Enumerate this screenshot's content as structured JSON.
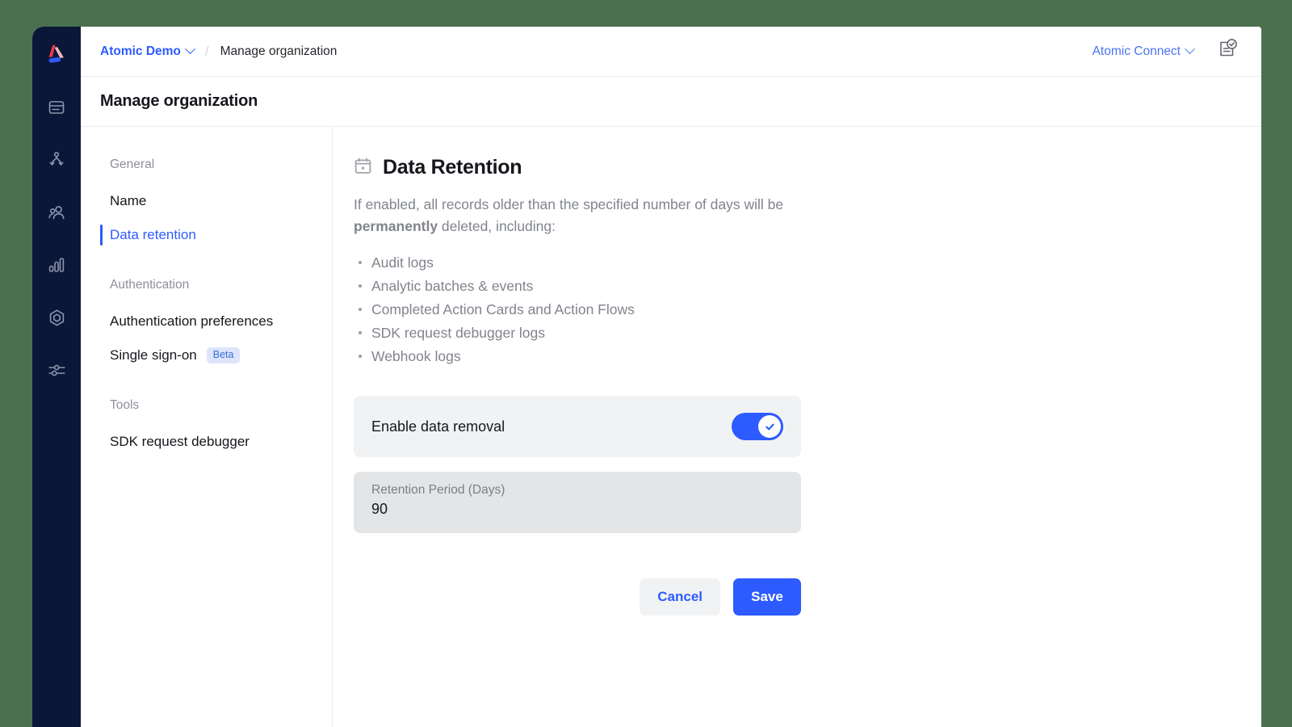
{
  "breadcrumb": {
    "org": "Atomic Demo",
    "separator": "/",
    "current": "Manage organization"
  },
  "topbar": {
    "connect_label": "Atomic Connect",
    "doc_check_icon": "document-check-icon"
  },
  "page": {
    "title": "Manage organization"
  },
  "rail": {
    "logo_icon": "atomic-logo-icon",
    "items": [
      {
        "icon": "card-list-icon"
      },
      {
        "icon": "flow-branch-icon"
      },
      {
        "icon": "people-icon"
      },
      {
        "icon": "bar-chart-icon"
      },
      {
        "icon": "hexagon-icon"
      },
      {
        "icon": "sliders-icon"
      }
    ]
  },
  "settings_nav": {
    "groups": [
      {
        "label": "General",
        "items": [
          {
            "label": "Name",
            "active": false,
            "badge": null
          },
          {
            "label": "Data retention",
            "active": true,
            "badge": null
          }
        ]
      },
      {
        "label": "Authentication",
        "items": [
          {
            "label": "Authentication preferences",
            "active": false,
            "badge": null
          },
          {
            "label": "Single sign-on",
            "active": false,
            "badge": "Beta"
          }
        ]
      },
      {
        "label": "Tools",
        "items": [
          {
            "label": "SDK request debugger",
            "active": false,
            "badge": null
          }
        ]
      }
    ]
  },
  "section": {
    "icon": "calendar-icon",
    "title": "Data Retention",
    "description_part1": "If enabled, all records older than the specified number of days will be ",
    "description_bold": "permanently",
    "description_part2": " deleted, including:",
    "bullets": [
      "Audit logs",
      "Analytic batches & events",
      "Completed Action Cards and Action Flows",
      "SDK request debugger logs",
      "Webhook logs"
    ]
  },
  "form": {
    "toggle_label": "Enable data removal",
    "toggle_on": true,
    "retention_label": "Retention Period (Days)",
    "retention_value": "90",
    "cancel_label": "Cancel",
    "save_label": "Save"
  },
  "colors": {
    "accent_blue": "#2d5bff",
    "rail_navy": "#0b1739",
    "page_background": "#4a7050",
    "badge_blue": "#3b6ae0"
  }
}
